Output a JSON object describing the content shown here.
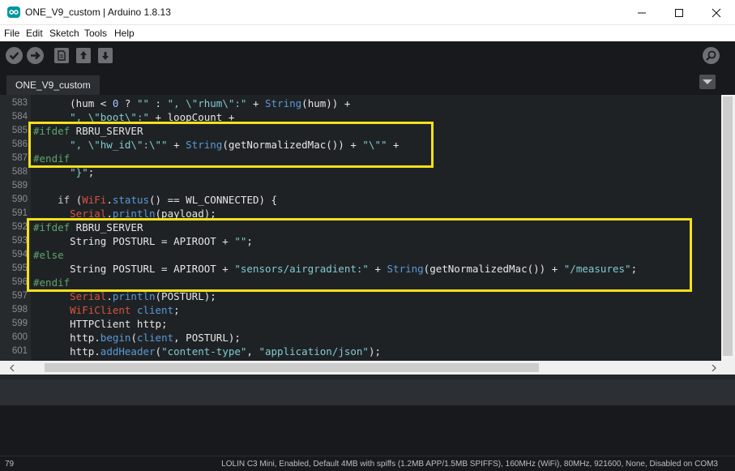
{
  "window": {
    "title": "ONE_V9_custom | Arduino 1.8.13"
  },
  "menu": [
    "File",
    "Edit",
    "Sketch",
    "Tools",
    "Help"
  ],
  "toolbar": {
    "buttons": [
      "verify-icon",
      "upload-icon",
      "new-icon",
      "open-icon",
      "save-icon",
      "serial-monitor-icon"
    ]
  },
  "tab": {
    "label": "ONE_V9_custom"
  },
  "editor": {
    "lines": [
      {
        "n": "583",
        "tokens": [
          [
            "tx",
            "      (hum < "
          ],
          [
            "num",
            "0"
          ],
          [
            "tx",
            " ? "
          ],
          [
            "str",
            "\"\""
          ],
          [
            "tx",
            " : "
          ],
          [
            "str",
            "\", \\\"rhum\\\":\""
          ],
          [
            "tx",
            " + "
          ],
          [
            "mt",
            "String"
          ],
          [
            "tx",
            "(hum)) +"
          ]
        ]
      },
      {
        "n": "584",
        "tokens": [
          [
            "tx",
            "      "
          ],
          [
            "str",
            "\", \\\"boot\\\":\""
          ],
          [
            "tx",
            " + loopCount +"
          ]
        ]
      },
      {
        "n": "585",
        "tokens": [
          [
            "pp",
            "#ifdef"
          ],
          [
            "tx",
            " RBRU_SERVER"
          ]
        ]
      },
      {
        "n": "586",
        "tokens": [
          [
            "tx",
            "      "
          ],
          [
            "str",
            "\", \\\"hw_id\\\":\\\"\""
          ],
          [
            "tx",
            " + "
          ],
          [
            "mt",
            "String"
          ],
          [
            "tx",
            "(getNormalizedMac()) + "
          ],
          [
            "str",
            "\"\\\"\""
          ],
          [
            "tx",
            " +"
          ]
        ]
      },
      {
        "n": "587",
        "tokens": [
          [
            "pp",
            "#endif"
          ]
        ]
      },
      {
        "n": "588",
        "tokens": [
          [
            "tx",
            "      "
          ],
          [
            "str",
            "\"}\""
          ],
          [
            "tx",
            ";"
          ]
        ]
      },
      {
        "n": "589",
        "tokens": [
          [
            "tx",
            ""
          ]
        ]
      },
      {
        "n": "590",
        "tokens": [
          [
            "tx",
            "    "
          ],
          [
            "kw",
            "if"
          ],
          [
            "tx",
            " ("
          ],
          [
            "fn",
            "WiFi"
          ],
          [
            "tx",
            "."
          ],
          [
            "mt",
            "status"
          ],
          [
            "tx",
            "() == WL_CONNECTED) {"
          ]
        ]
      },
      {
        "n": "591",
        "tokens": [
          [
            "tx",
            "      "
          ],
          [
            "fn",
            "Serial"
          ],
          [
            "tx",
            "."
          ],
          [
            "mt",
            "println"
          ],
          [
            "tx",
            "(payload);"
          ]
        ]
      },
      {
        "n": "592",
        "tokens": [
          [
            "pp",
            "#ifdef"
          ],
          [
            "tx",
            " RBRU_SERVER"
          ]
        ]
      },
      {
        "n": "593",
        "tokens": [
          [
            "tx",
            "      String POSTURL = APIROOT + "
          ],
          [
            "str",
            "\"\""
          ],
          [
            "tx",
            ";"
          ]
        ]
      },
      {
        "n": "594",
        "tokens": [
          [
            "pp",
            "#else"
          ]
        ]
      },
      {
        "n": "595",
        "tokens": [
          [
            "tx",
            "      String POSTURL = APIROOT + "
          ],
          [
            "str",
            "\"sensors/airgradient:\""
          ],
          [
            "tx",
            " + "
          ],
          [
            "mt",
            "String"
          ],
          [
            "tx",
            "(getNormalizedMac()) + "
          ],
          [
            "str",
            "\"/measures\""
          ],
          [
            "tx",
            ";"
          ]
        ]
      },
      {
        "n": "596",
        "tokens": [
          [
            "pp",
            "#endif"
          ]
        ]
      },
      {
        "n": "597",
        "tokens": [
          [
            "tx",
            "      "
          ],
          [
            "fn",
            "Serial"
          ],
          [
            "tx",
            "."
          ],
          [
            "mt",
            "println"
          ],
          [
            "tx",
            "(POSTURL);"
          ]
        ]
      },
      {
        "n": "598",
        "tokens": [
          [
            "tx",
            "      "
          ],
          [
            "fn",
            "WiFiClient"
          ],
          [
            "tx",
            " "
          ],
          [
            "mt",
            "client"
          ],
          [
            "tx",
            ";"
          ]
        ]
      },
      {
        "n": "599",
        "tokens": [
          [
            "tx",
            "      HTTPClient http;"
          ]
        ]
      },
      {
        "n": "600",
        "tokens": [
          [
            "tx",
            "      http."
          ],
          [
            "mt",
            "begin"
          ],
          [
            "tx",
            "("
          ],
          [
            "mt",
            "client"
          ],
          [
            "tx",
            ", POSTURL);"
          ]
        ]
      },
      {
        "n": "601",
        "tokens": [
          [
            "tx",
            "      http."
          ],
          [
            "mt",
            "addHeader"
          ],
          [
            "tx",
            "("
          ],
          [
            "str",
            "\"content-type\""
          ],
          [
            "tx",
            ", "
          ],
          [
            "str",
            "\"application/json\""
          ],
          [
            "tx",
            ");"
          ]
        ]
      }
    ]
  },
  "colors": {
    "highlight": "#f4e01b",
    "editor_bg": "#1f2225",
    "accent": "#00979c"
  },
  "status": {
    "line_number": "79",
    "board": "LOLIN C3 Mini, Enabled, Default 4MB with spiffs (1.2MB APP/1.5MB SPIFFS), 160MHz (WiFi), 80MHz, 921600, None, Disabled on COM3"
  }
}
